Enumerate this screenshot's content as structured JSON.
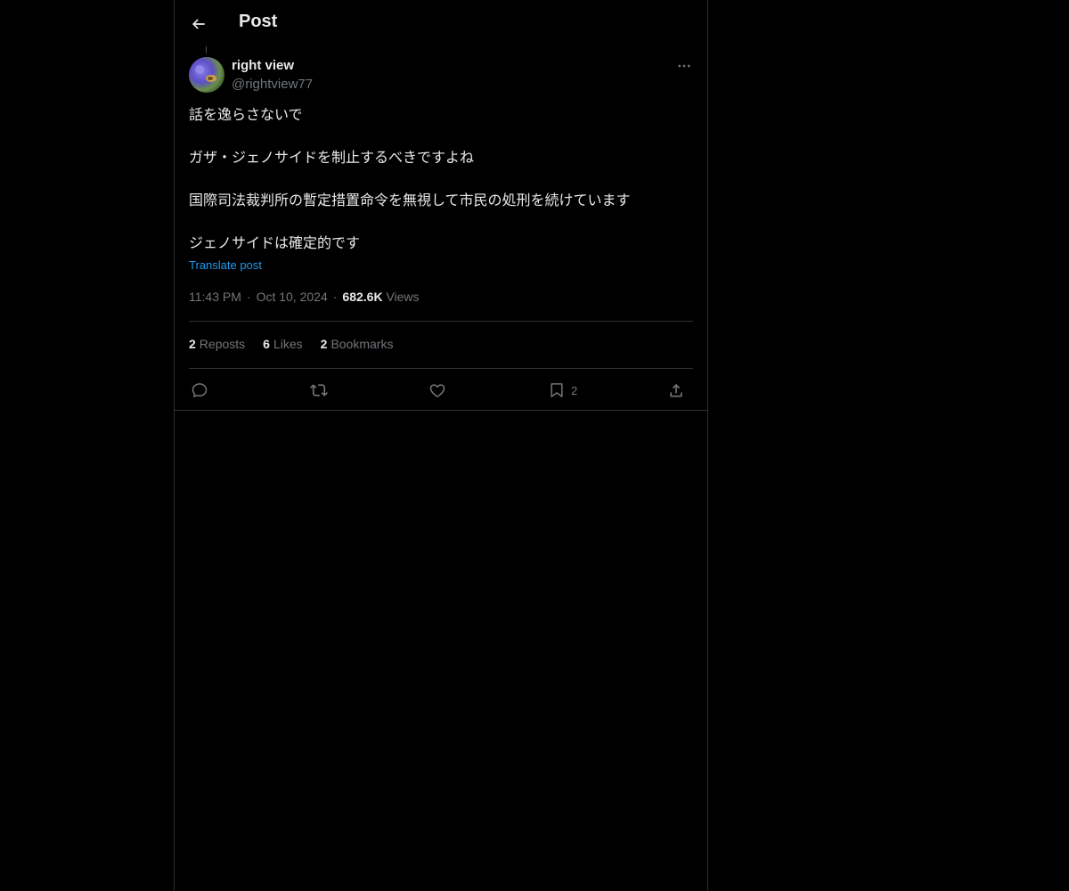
{
  "header": {
    "title": "Post",
    "back_icon": "arrow-left-icon"
  },
  "author": {
    "name": "right view",
    "handle": "@rightview77"
  },
  "post": {
    "paragraphs": [
      "話を逸らさないで",
      "ガザ・ジェノサイドを制止するべきですよね",
      "国際司法裁判所の暫定措置命令を無視して市民の処刑を続けています",
      "ジェノサイドは確定的です"
    ],
    "translate_label": "Translate post",
    "time": "11:43 PM",
    "date": "Oct 10, 2024",
    "views_count": "682.6K",
    "views_label": "Views",
    "separator": "·"
  },
  "stats": {
    "reposts_count": "2",
    "reposts_label": "Reposts",
    "likes_count": "6",
    "likes_label": "Likes",
    "bookmarks_count": "2",
    "bookmarks_label": "Bookmarks"
  },
  "actions": {
    "reply_icon": "reply-icon",
    "repost_icon": "repost-icon",
    "like_icon": "heart-icon",
    "bookmark_icon": "bookmark-icon",
    "bookmark_count": "2",
    "share_icon": "share-icon"
  },
  "colors": {
    "background": "#000000",
    "text_primary": "#e7e9ea",
    "text_secondary": "#71767b",
    "link": "#1d9bf0",
    "border": "#2f3336"
  }
}
